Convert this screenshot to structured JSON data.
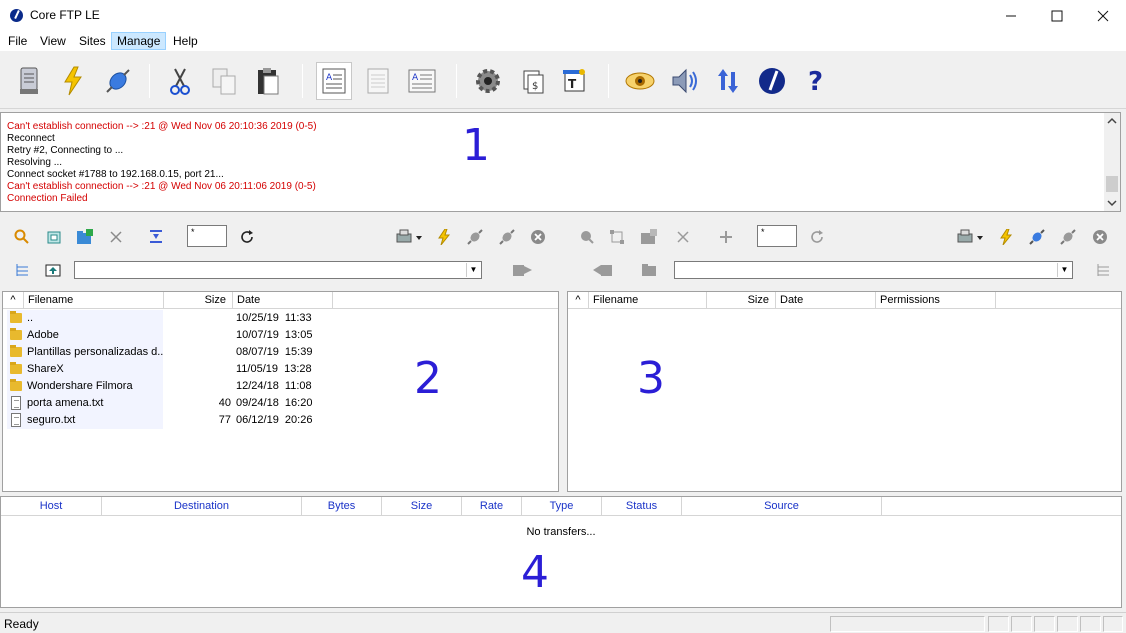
{
  "window": {
    "title": "Core FTP LE"
  },
  "menu": [
    "File",
    "View",
    "Sites",
    "Manage",
    "Help"
  ],
  "log": {
    "lines": [
      {
        "text": "Can't establish connection --> :21 @ Wed Nov 06 20:10:36 2019  (0-5)",
        "error": true
      },
      {
        "text": "Reconnect",
        "error": false
      },
      {
        "text": "Retry #2, Connecting to ...",
        "error": false
      },
      {
        "text": "Resolving ...",
        "error": false
      },
      {
        "text": "Connect socket #1788 to 192.168.0.15, port 21...",
        "error": false
      },
      {
        "text": "Can't establish connection --> :21 @ Wed Nov 06 20:11:06 2019  (0-5)",
        "error": true
      },
      {
        "text": "Connection Failed",
        "error": true
      }
    ]
  },
  "markers": {
    "log": "1",
    "local": "2",
    "remote": "3",
    "queue": "4"
  },
  "local": {
    "filter_value": "*",
    "columns": {
      "sort": "^",
      "filename": "Filename",
      "size": "Size",
      "date": "Date"
    },
    "files": [
      {
        "name": "..",
        "size": "",
        "date": "10/25/19  11:33",
        "type": "folder"
      },
      {
        "name": "Adobe",
        "size": "",
        "date": "10/07/19  13:05",
        "type": "folder"
      },
      {
        "name": "Plantillas personalizadas d...",
        "size": "",
        "date": "08/07/19  15:39",
        "type": "folder"
      },
      {
        "name": "ShareX",
        "size": "",
        "date": "11/05/19  13:28",
        "type": "folder"
      },
      {
        "name": "Wondershare Filmora",
        "size": "",
        "date": "12/24/18  11:08",
        "type": "folder"
      },
      {
        "name": "porta amena.txt",
        "size": "40",
        "date": "09/24/18  16:20",
        "type": "file"
      },
      {
        "name": "seguro.txt",
        "size": "77",
        "date": "06/12/19  20:26",
        "type": "file"
      }
    ]
  },
  "remote": {
    "filter_value": "*",
    "columns": {
      "sort": "^",
      "filename": "Filename",
      "size": "Size",
      "date": "Date",
      "permissions": "Permissions"
    }
  },
  "queue": {
    "columns": [
      "Host",
      "Destination",
      "Bytes",
      "Size",
      "Rate",
      "Type",
      "Status",
      "Source"
    ],
    "empty_text": "No transfers..."
  },
  "status": {
    "text": "Ready"
  }
}
